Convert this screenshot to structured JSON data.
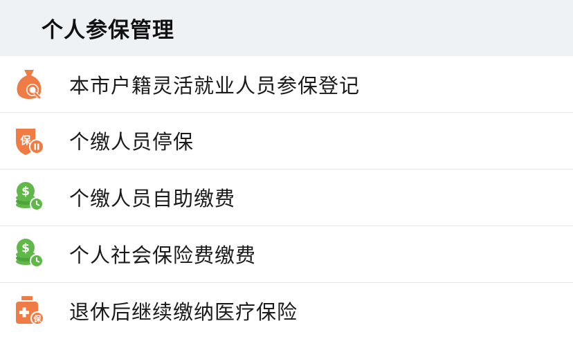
{
  "header": {
    "title": "个人参保管理"
  },
  "colors": {
    "orange": "#ef7b45",
    "green": "#5fb848",
    "header_bg": "#eff2f5"
  },
  "items": [
    {
      "label": "本市户籍灵活就业人员参保登记",
      "icon": "money-bag-search-icon"
    },
    {
      "label": "个缴人员停保",
      "icon": "insurance-pause-icon"
    },
    {
      "label": "个缴人员自助缴费",
      "icon": "coins-clock-icon"
    },
    {
      "label": "个人社会保险费缴费",
      "icon": "coins-clock-icon"
    },
    {
      "label": "退休后继续缴纳医疗保险",
      "icon": "medical-kit-insurance-icon"
    }
  ]
}
